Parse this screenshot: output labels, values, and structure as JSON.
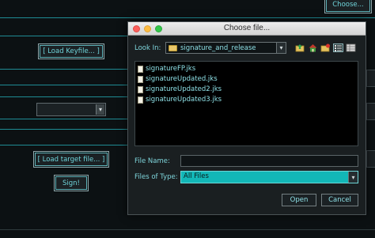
{
  "background": {
    "choose_button": "Choose...",
    "load_keyfile_button": "[ Load Keyfile... ]",
    "load_target_button": "[ Load target file... ]",
    "sign_button": "Sign!",
    "accent_color": "#1f8c94"
  },
  "dialog": {
    "title": "Choose file...",
    "look_in_label": "Look In:",
    "look_in_value": "signature_and_release",
    "toolbar": [
      "up-one-level-icon",
      "home-icon",
      "new-folder-icon",
      "list-view-icon",
      "details-view-icon"
    ],
    "files": [
      "signatureFP.jks",
      "signatureUpdated.jks",
      "signatureUpdated2.jks",
      "signatureUpdated3.jks"
    ],
    "file_name_label": "File Name:",
    "file_name_value": "",
    "files_of_type_label": "Files of Type:",
    "files_of_type_value": "All Files",
    "open_button": "Open",
    "cancel_button": "Cancel",
    "selection_color": "#12b7b7"
  }
}
